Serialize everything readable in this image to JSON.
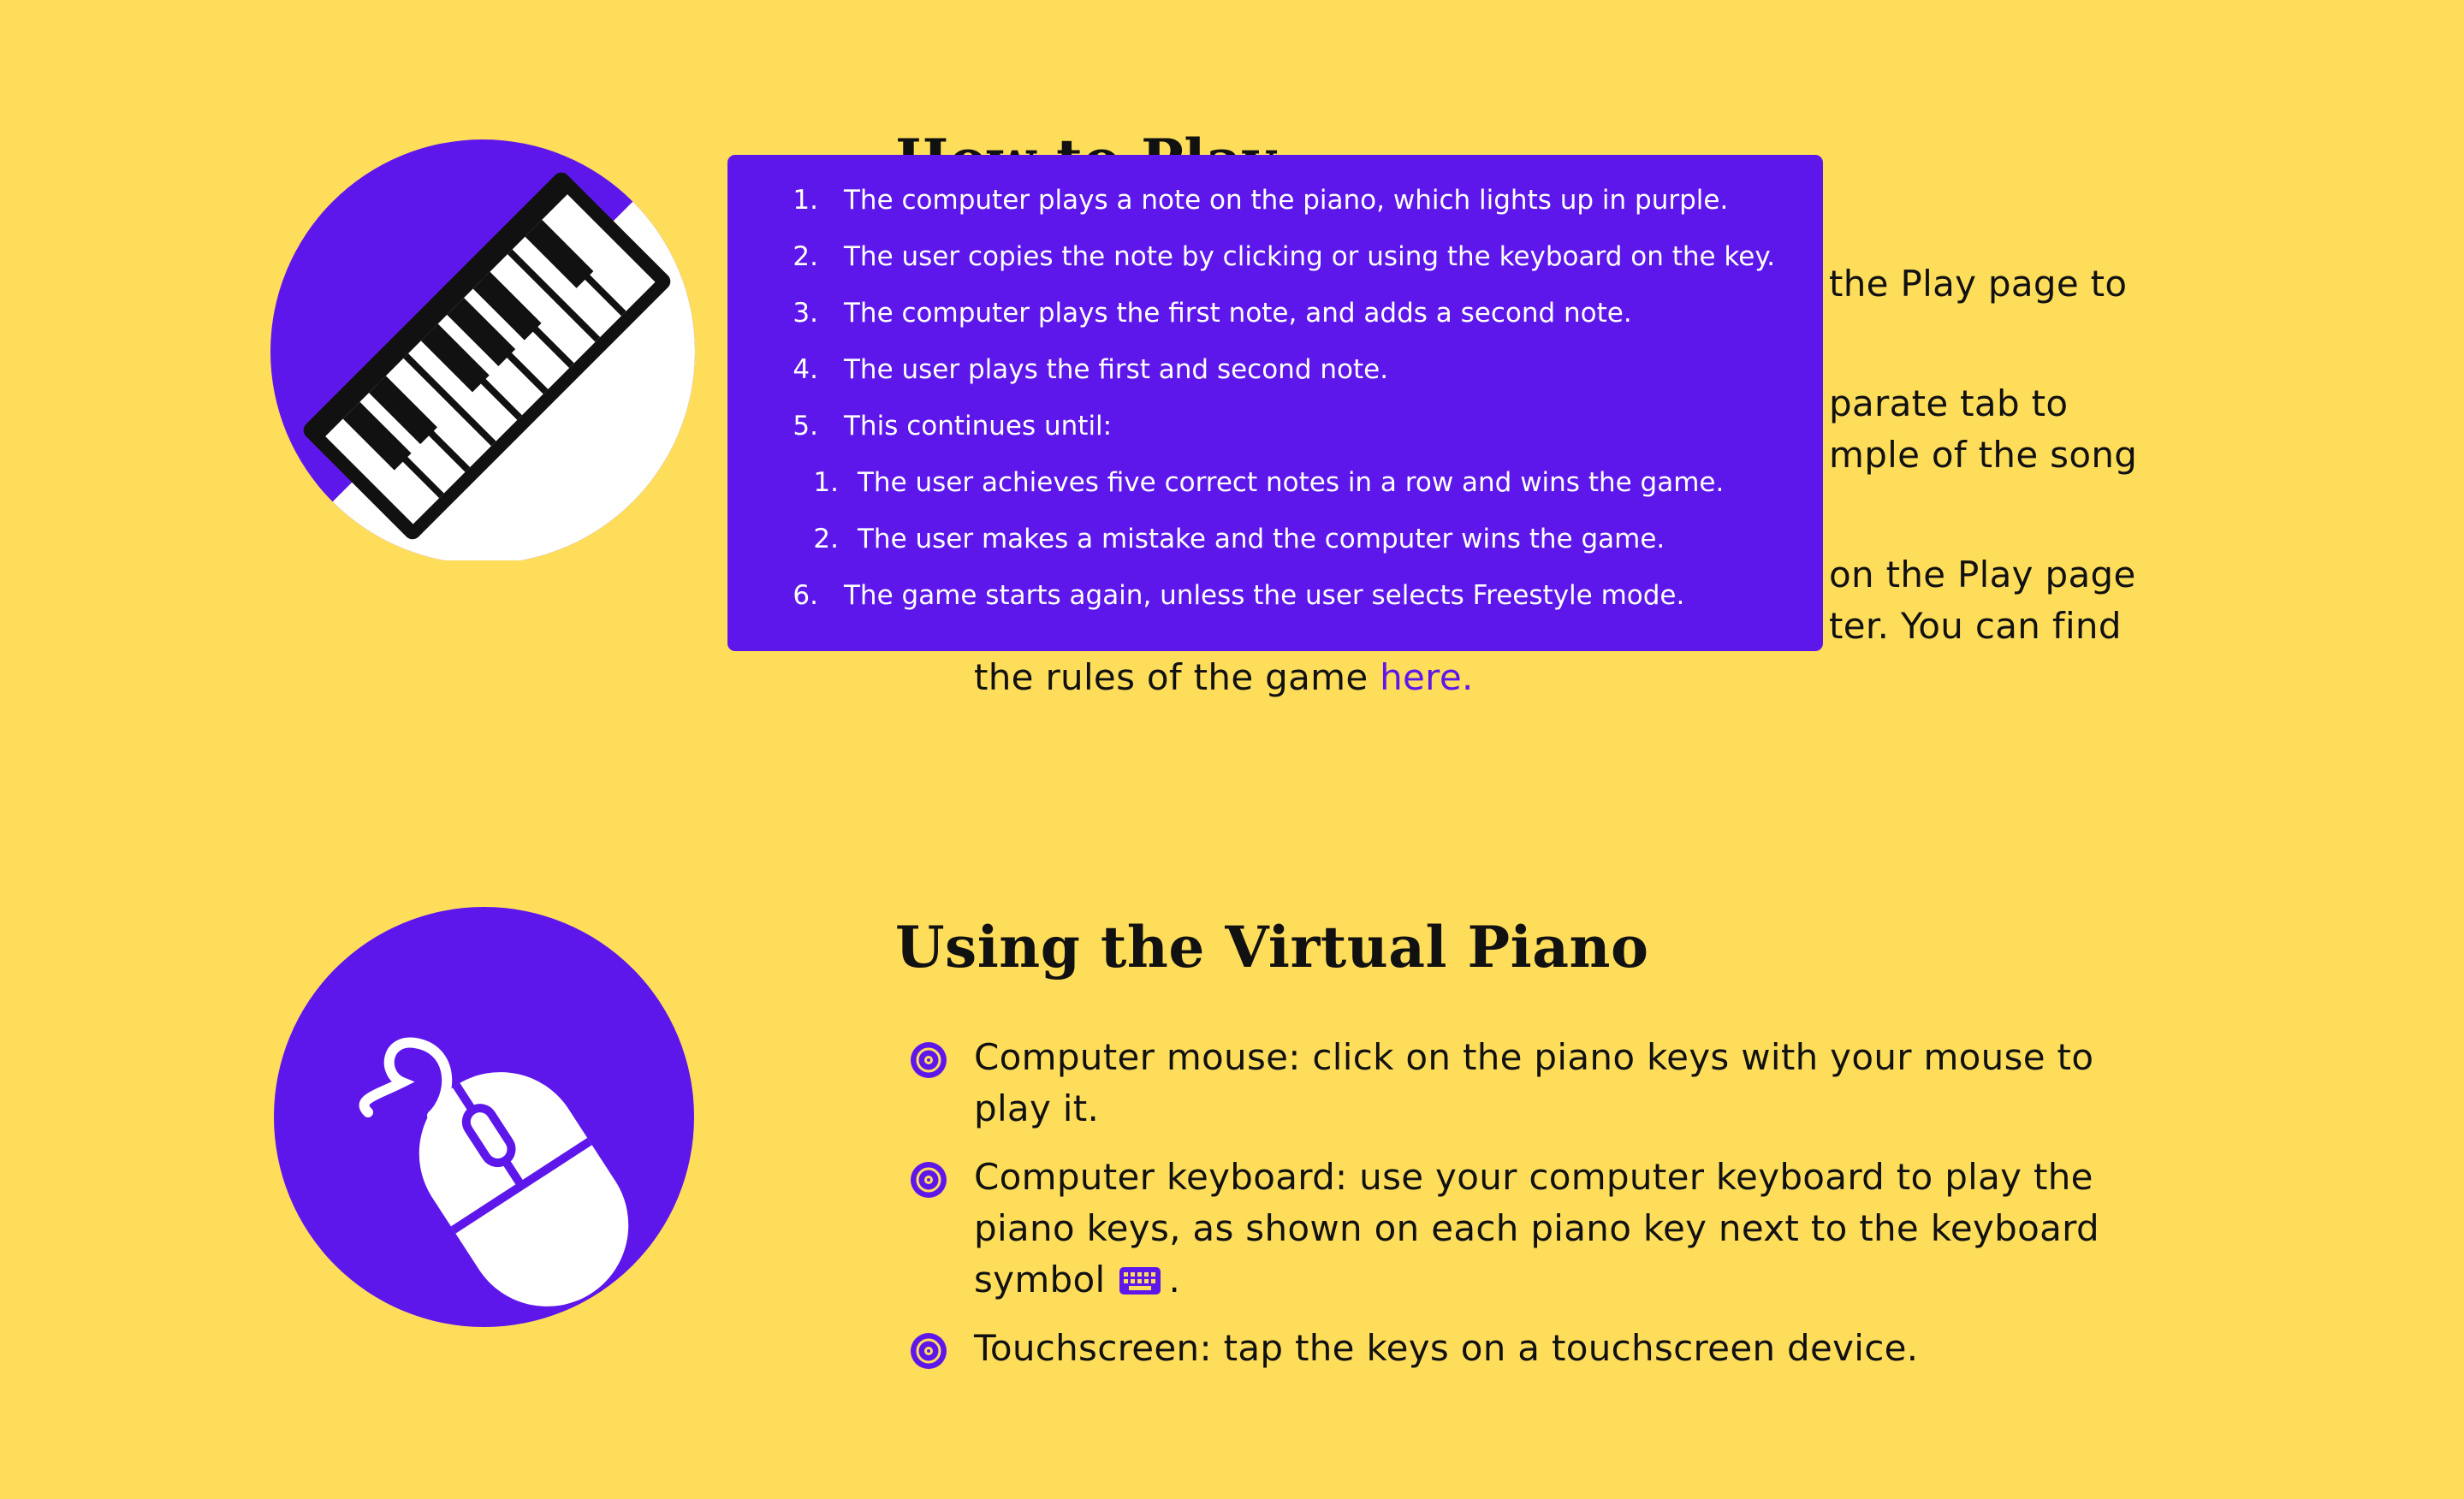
{
  "sections": {
    "how_to_play": {
      "heading": "How to Play",
      "lines": [
        "the Play page to",
        "parate tab to",
        "mple of the song",
        "on the Play page",
        "ter. You can find"
      ],
      "rules_line": "the rules of the game",
      "rules_link": "here."
    },
    "virtual_piano": {
      "heading": "Using the Virtual Piano",
      "bullets": [
        "Computer mouse: click on the piano keys with your mouse to play it.",
        "Computer keyboard: use your computer keyboard to play the piano keys, as shown on each piano key next to the keyboard symbol",
        "Touchscreen: tap the keys on a touchscreen device."
      ],
      "bullet_2_suffix": "."
    }
  },
  "popup": {
    "items": [
      {
        "num": "1.",
        "text": "The computer plays a note on the piano, which lights up in purple."
      },
      {
        "num": "2.",
        "text": "The user copies the note by clicking or using the keyboard on the key."
      },
      {
        "num": "3.",
        "text": "The computer plays the first note, and adds a second note."
      },
      {
        "num": "4.",
        "text": "The user plays the first and second note."
      },
      {
        "num": "5.",
        "text": "This continues until:"
      },
      {
        "num": "1.",
        "text": "The user achieves five correct notes in a row and wins the game."
      },
      {
        "num": "2.",
        "text": "The user makes a mistake and the computer wins the game."
      },
      {
        "num": "6.",
        "text": "The game starts again, unless the user selects Freestyle mode."
      }
    ]
  },
  "icons": {
    "piano": "piano-keys-icon",
    "mouse": "computer-mouse-icon",
    "bullet": "vinyl-record-icon",
    "keyboard": "keyboard-icon"
  },
  "colors": {
    "background": "#FEDD5B",
    "accent": "#5E17EB",
    "text": "#111111"
  }
}
